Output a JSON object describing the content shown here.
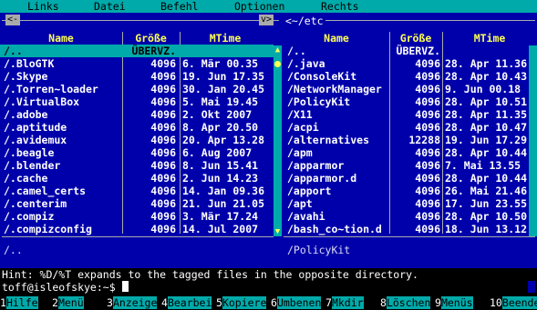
{
  "menu": [
    "Links",
    "Datei",
    "Befehl",
    "Optionen",
    "Rechts"
  ],
  "left_panel": {
    "path": "",
    "sort_indicator": "v>",
    "columns": [
      "Name",
      "Größe",
      "MTime"
    ],
    "rows": [
      {
        "name": "/..",
        "size": "ÜBERVZ.",
        "time": ""
      },
      {
        "name": "/.BloGTK",
        "size": "4096",
        "time": "6. Mär 00.35"
      },
      {
        "name": "/.Skype",
        "size": "4096",
        "time": "19. Jun 17.35"
      },
      {
        "name": "/.Torren~loader",
        "size": "4096",
        "time": "30. Jan 20.45"
      },
      {
        "name": "/.VirtualBox",
        "size": "4096",
        "time": "5. Mai 19.45"
      },
      {
        "name": "/.adobe",
        "size": "4096",
        "time": "2. Okt 2007"
      },
      {
        "name": "/.aptitude",
        "size": "4096",
        "time": "8. Apr 20.50"
      },
      {
        "name": "/.avidemux",
        "size": "4096",
        "time": "20. Apr 13.28"
      },
      {
        "name": "/.beagle",
        "size": "4096",
        "time": "6. Aug 2007"
      },
      {
        "name": "/.blender",
        "size": "4096",
        "time": "8. Jun 15.41"
      },
      {
        "name": "/.cache",
        "size": "4096",
        "time": "2. Jun 14.23"
      },
      {
        "name": "/.camel_certs",
        "size": "4096",
        "time": "14. Jan 09.36"
      },
      {
        "name": "/.centerim",
        "size": "4096",
        "time": "21. Jun 21.05"
      },
      {
        "name": "/.compiz",
        "size": "4096",
        "time": "3. Mär 17.24"
      },
      {
        "name": "/.compizconfig",
        "size": "4096",
        "time": "14. Jul 2007"
      }
    ],
    "mini_status": "/.."
  },
  "right_panel": {
    "path": "<~/etc",
    "sort_indicator": "v",
    "columns": [
      "Name",
      "Größe",
      "MTime"
    ],
    "rows": [
      {
        "name": "/..",
        "size": "ÜBERVZ.",
        "time": ""
      },
      {
        "name": "/.java",
        "size": "4096",
        "time": "28. Apr 11.36"
      },
      {
        "name": "/ConsoleKit",
        "size": "4096",
        "time": "28. Apr 10.43"
      },
      {
        "name": "/NetworkManager",
        "size": "4096",
        "time": "9. Jun 00.18"
      },
      {
        "name": "/PolicyKit",
        "size": "4096",
        "time": "28. Apr 10.51"
      },
      {
        "name": "/X11",
        "size": "4096",
        "time": "28. Apr 11.35"
      },
      {
        "name": "/acpi",
        "size": "4096",
        "time": "28. Apr 10.47"
      },
      {
        "name": "/alternatives",
        "size": "12288",
        "time": "19. Jun 17.29"
      },
      {
        "name": "/apm",
        "size": "4096",
        "time": "28. Apr 10.44"
      },
      {
        "name": "/apparmor",
        "size": "4096",
        "time": "7. Mai 13.55"
      },
      {
        "name": "/apparmor.d",
        "size": "4096",
        "time": "28. Apr 10.44"
      },
      {
        "name": "/apport",
        "size": "4096",
        "time": "26. Mai 21.46"
      },
      {
        "name": "/apt",
        "size": "4096",
        "time": "17. Jun 23.55"
      },
      {
        "name": "/avahi",
        "size": "4096",
        "time": "28. Apr 10.50"
      },
      {
        "name": "/bash_co~tion.d",
        "size": "4096",
        "time": "18. Jun 13.12"
      }
    ],
    "mini_status": "/PolicyKit"
  },
  "hint": "Hint: %D/%T expands to the tagged files in the opposite directory.",
  "prompt": "toff@isleofskye:~$ ",
  "fkeys": [
    {
      "num": "1",
      "label": "Hilfe"
    },
    {
      "num": "2",
      "label": "Menü"
    },
    {
      "num": "3",
      "label": "Anzeige"
    },
    {
      "num": "4",
      "label": "Bearbei"
    },
    {
      "num": "5",
      "label": "Kopiere"
    },
    {
      "num": "6",
      "label": "Umbenen"
    },
    {
      "num": "7",
      "label": "Mkdir"
    },
    {
      "num": "8",
      "label": "Löschen"
    },
    {
      "num": "9",
      "label": "Menüs"
    },
    {
      "num": "10",
      "label": "Beenden"
    }
  ],
  "colors": {
    "panel_bg": "#0000aa",
    "menu_bg": "#00aaaa",
    "header_fg": "#ffff55",
    "selection_bg": "#00aaaa"
  }
}
